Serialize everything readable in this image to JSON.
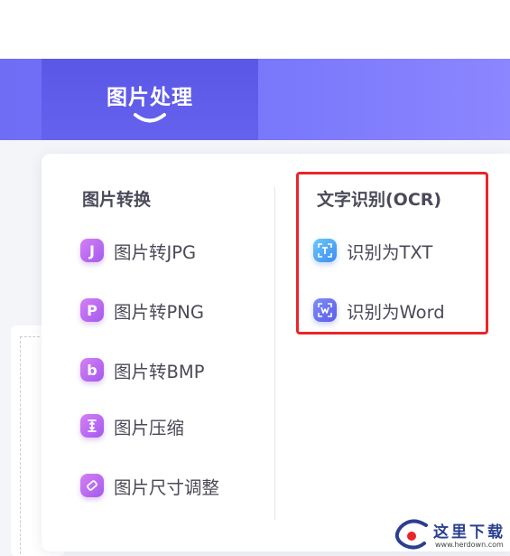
{
  "nav": {
    "active_tab": "图片处理"
  },
  "image_conversion": {
    "title": "图片转换",
    "items": [
      {
        "label": "图片转JPG",
        "icon": "letter-j-icon"
      },
      {
        "label": "图片转PNG",
        "icon": "letter-p-icon"
      },
      {
        "label": "图片转BMP",
        "icon": "letter-b-icon"
      },
      {
        "label": "图片压缩",
        "icon": "compress-icon"
      },
      {
        "label": "图片尺寸调整",
        "icon": "resize-icon"
      }
    ]
  },
  "ocr": {
    "title": "文字识别(OCR)",
    "items": [
      {
        "label": "识别为TXT",
        "icon": "text-scan-icon"
      },
      {
        "label": "识别为Word",
        "icon": "word-scan-icon"
      }
    ]
  },
  "watermark": {
    "text": "这里下载",
    "url": "www.herdown.com"
  },
  "colors": {
    "accent": "#6f6df5",
    "active_tab": "#5b57e6",
    "highlight": "#e8262a",
    "icon_purple": "#b865f1"
  }
}
